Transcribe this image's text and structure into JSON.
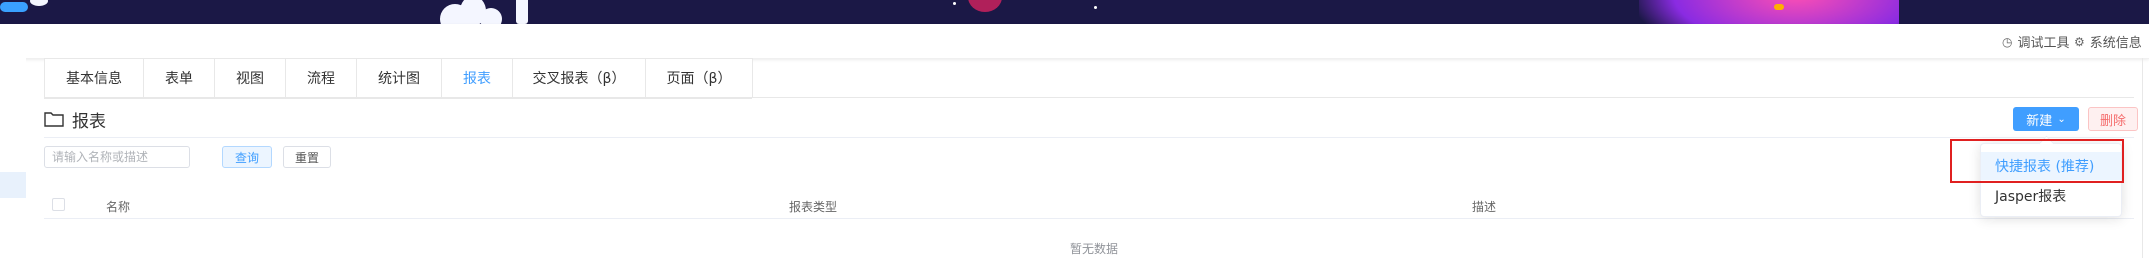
{
  "toolbar": {
    "debug_tool_label": "调试工具",
    "system_info_label": "系统信息"
  },
  "tabs": [
    {
      "label": "基本信息"
    },
    {
      "label": "表单"
    },
    {
      "label": "视图"
    },
    {
      "label": "流程"
    },
    {
      "label": "统计图"
    },
    {
      "label": "报表"
    },
    {
      "label": "交叉报表（β）"
    },
    {
      "label": "页面（β）"
    }
  ],
  "active_tab": "报表",
  "page": {
    "title": "报表",
    "new_button_label": "新建",
    "delete_button_label": "删除"
  },
  "search": {
    "placeholder": "请输入名称或描述",
    "value": "",
    "query_label": "查询",
    "reset_label": "重置"
  },
  "table": {
    "columns": [
      "名称",
      "报表类型",
      "描述"
    ],
    "empty_text": "暂无数据"
  },
  "new_dropdown": {
    "items": [
      {
        "label": "快捷报表 (推荐)"
      },
      {
        "label": "Jasper报表"
      }
    ]
  },
  "colors": {
    "banner": "#1b1846",
    "primary": "#409eff",
    "danger": "#f56c6c",
    "highlight": "#e02020"
  }
}
